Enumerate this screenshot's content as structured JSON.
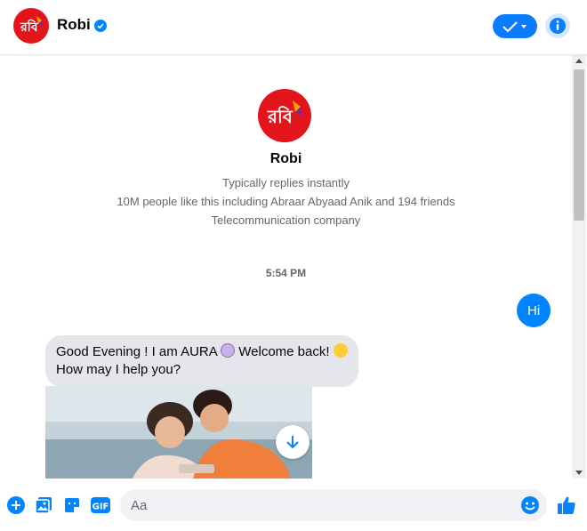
{
  "header": {
    "name": "Robi",
    "logo_text": "রবি",
    "verified_icon": "verified-badge-icon",
    "status_icon": "check-dropdown-icon",
    "info_icon": "info-icon"
  },
  "profile": {
    "name": "Robi",
    "logo_text": "রবি",
    "reply_time": "Typically replies instantly",
    "likes": "10M people like this including Abraar Abyaad Anik and 194 friends",
    "category": "Telecommunication company"
  },
  "thread": {
    "timestamp": "5:54 PM",
    "outgoing_message": "Hi",
    "incoming_part1": "Good Evening ! I am AURA ",
    "incoming_part2": " Welcome back! ",
    "incoming_part3": "How may I help you?"
  },
  "composer": {
    "placeholder": "Aa",
    "gif_label": "GIF"
  },
  "colors": {
    "brand_red": "#e3141b",
    "accent_blue": "#0084ff",
    "bubble_gray": "#e4e6eb"
  }
}
